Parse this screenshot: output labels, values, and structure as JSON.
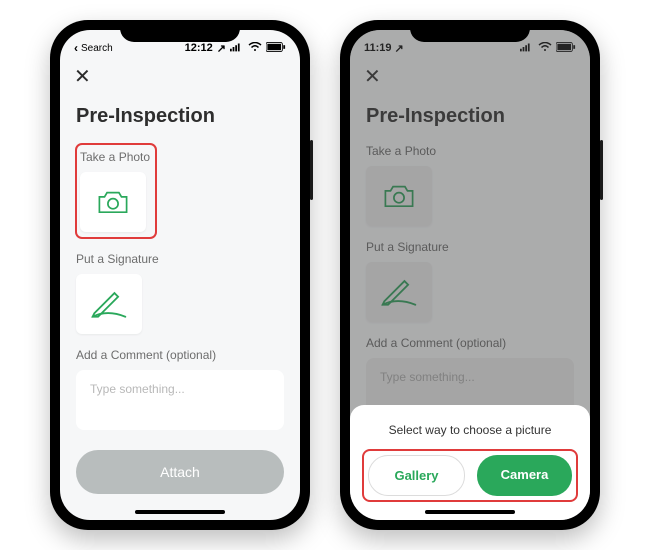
{
  "left": {
    "status": {
      "time": "12:12",
      "back_label": "Search",
      "location_arrow": "↗"
    },
    "page_title": "Pre-Inspection",
    "photo_label": "Take a Photo",
    "signature_label": "Put a Signature",
    "comment_label": "Add a Comment (optional)",
    "comment_placeholder": "Type something...",
    "attach_label": "Attach"
  },
  "right": {
    "status": {
      "time": "11:19",
      "location_arrow": "↗"
    },
    "page_title": "Pre-Inspection",
    "photo_label": "Take a Photo",
    "signature_label": "Put a Signature",
    "comment_label": "Add a Comment (optional)",
    "comment_placeholder": "Type something...",
    "sheet_title": "Select way to choose a picture",
    "gallery_label": "Gallery",
    "camera_label": "Camera"
  }
}
